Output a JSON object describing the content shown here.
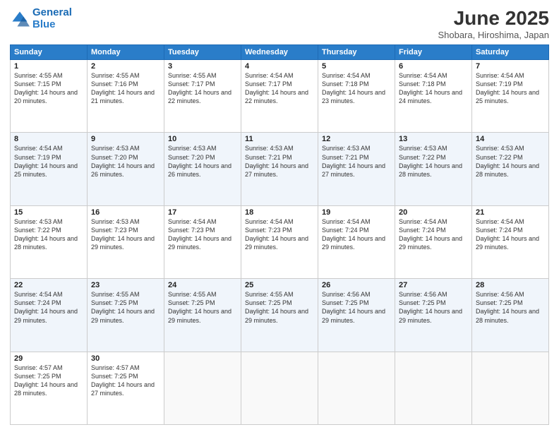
{
  "header": {
    "logo_line1": "General",
    "logo_line2": "Blue",
    "title": "June 2025",
    "subtitle": "Shobara, Hiroshima, Japan"
  },
  "calendar": {
    "headers": [
      "Sunday",
      "Monday",
      "Tuesday",
      "Wednesday",
      "Thursday",
      "Friday",
      "Saturday"
    ],
    "weeks": [
      [
        null,
        {
          "day": "2",
          "sunrise": "4:55 AM",
          "sunset": "7:16 PM",
          "daylight": "14 hours and 21 minutes."
        },
        {
          "day": "3",
          "sunrise": "4:55 AM",
          "sunset": "7:17 PM",
          "daylight": "14 hours and 22 minutes."
        },
        {
          "day": "4",
          "sunrise": "4:54 AM",
          "sunset": "7:17 PM",
          "daylight": "14 hours and 22 minutes."
        },
        {
          "day": "5",
          "sunrise": "4:54 AM",
          "sunset": "7:18 PM",
          "daylight": "14 hours and 23 minutes."
        },
        {
          "day": "6",
          "sunrise": "4:54 AM",
          "sunset": "7:18 PM",
          "daylight": "14 hours and 24 minutes."
        },
        {
          "day": "7",
          "sunrise": "4:54 AM",
          "sunset": "7:19 PM",
          "daylight": "14 hours and 25 minutes."
        }
      ],
      [
        {
          "day": "1",
          "sunrise": "4:55 AM",
          "sunset": "7:15 PM",
          "daylight": "14 hours and 20 minutes."
        },
        {
          "day": "9",
          "sunrise": "4:53 AM",
          "sunset": "7:20 PM",
          "daylight": "14 hours and 26 minutes."
        },
        {
          "day": "10",
          "sunrise": "4:53 AM",
          "sunset": "7:20 PM",
          "daylight": "14 hours and 26 minutes."
        },
        {
          "day": "11",
          "sunrise": "4:53 AM",
          "sunset": "7:21 PM",
          "daylight": "14 hours and 27 minutes."
        },
        {
          "day": "12",
          "sunrise": "4:53 AM",
          "sunset": "7:21 PM",
          "daylight": "14 hours and 27 minutes."
        },
        {
          "day": "13",
          "sunrise": "4:53 AM",
          "sunset": "7:22 PM",
          "daylight": "14 hours and 28 minutes."
        },
        {
          "day": "14",
          "sunrise": "4:53 AM",
          "sunset": "7:22 PM",
          "daylight": "14 hours and 28 minutes."
        }
      ],
      [
        {
          "day": "8",
          "sunrise": "4:54 AM",
          "sunset": "7:19 PM",
          "daylight": "14 hours and 25 minutes."
        },
        {
          "day": "16",
          "sunrise": "4:53 AM",
          "sunset": "7:23 PM",
          "daylight": "14 hours and 29 minutes."
        },
        {
          "day": "17",
          "sunrise": "4:54 AM",
          "sunset": "7:23 PM",
          "daylight": "14 hours and 29 minutes."
        },
        {
          "day": "18",
          "sunrise": "4:54 AM",
          "sunset": "7:23 PM",
          "daylight": "14 hours and 29 minutes."
        },
        {
          "day": "19",
          "sunrise": "4:54 AM",
          "sunset": "7:24 PM",
          "daylight": "14 hours and 29 minutes."
        },
        {
          "day": "20",
          "sunrise": "4:54 AM",
          "sunset": "7:24 PM",
          "daylight": "14 hours and 29 minutes."
        },
        {
          "day": "21",
          "sunrise": "4:54 AM",
          "sunset": "7:24 PM",
          "daylight": "14 hours and 29 minutes."
        }
      ],
      [
        {
          "day": "15",
          "sunrise": "4:53 AM",
          "sunset": "7:22 PM",
          "daylight": "14 hours and 28 minutes."
        },
        {
          "day": "23",
          "sunrise": "4:55 AM",
          "sunset": "7:25 PM",
          "daylight": "14 hours and 29 minutes."
        },
        {
          "day": "24",
          "sunrise": "4:55 AM",
          "sunset": "7:25 PM",
          "daylight": "14 hours and 29 minutes."
        },
        {
          "day": "25",
          "sunrise": "4:55 AM",
          "sunset": "7:25 PM",
          "daylight": "14 hours and 29 minutes."
        },
        {
          "day": "26",
          "sunrise": "4:56 AM",
          "sunset": "7:25 PM",
          "daylight": "14 hours and 29 minutes."
        },
        {
          "day": "27",
          "sunrise": "4:56 AM",
          "sunset": "7:25 PM",
          "daylight": "14 hours and 29 minutes."
        },
        {
          "day": "28",
          "sunrise": "4:56 AM",
          "sunset": "7:25 PM",
          "daylight": "14 hours and 28 minutes."
        }
      ],
      [
        {
          "day": "22",
          "sunrise": "4:54 AM",
          "sunset": "7:24 PM",
          "daylight": "14 hours and 29 minutes."
        },
        {
          "day": "30",
          "sunrise": "4:57 AM",
          "sunset": "7:25 PM",
          "daylight": "14 hours and 27 minutes."
        },
        null,
        null,
        null,
        null,
        null
      ],
      [
        {
          "day": "29",
          "sunrise": "4:57 AM",
          "sunset": "7:25 PM",
          "daylight": "14 hours and 28 minutes."
        },
        null,
        null,
        null,
        null,
        null,
        null
      ]
    ]
  }
}
